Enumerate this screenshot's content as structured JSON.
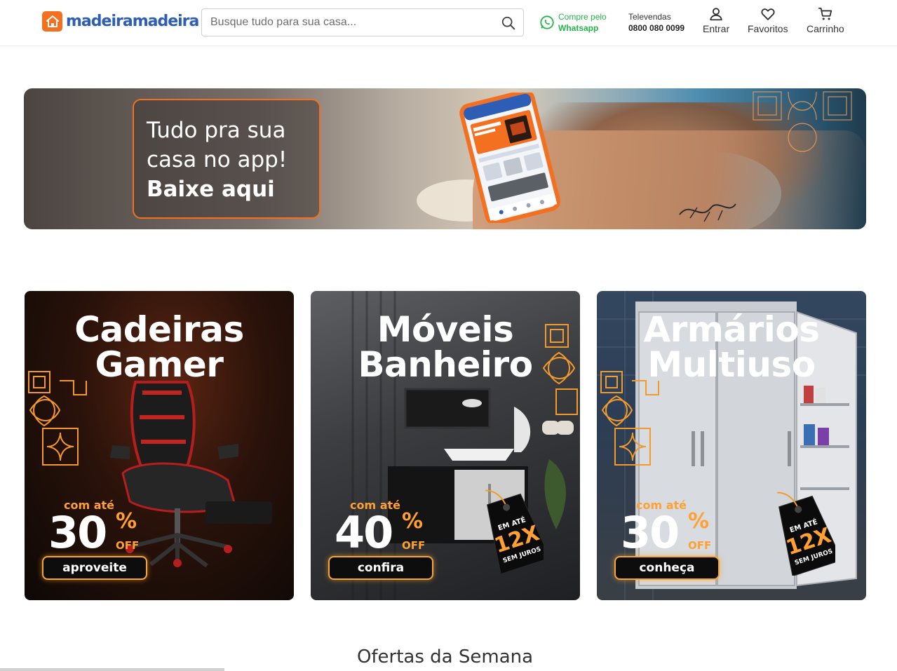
{
  "header": {
    "logo": {
      "part1": "madeira",
      "part2": "madeira"
    },
    "search": {
      "placeholder": "Busque tudo para sua casa..."
    },
    "whatsapp": {
      "line1": "Compre pelo",
      "line2": "Whatsapp"
    },
    "televendas": {
      "label": "Televendas",
      "phone": "0800 080 0099"
    },
    "nav": {
      "login": "Entrar",
      "favorites": "Favoritos",
      "cart": "Carrinho"
    }
  },
  "app_banner": {
    "line1": "Tudo pra sua",
    "line2": "casa no app!",
    "line3": "Baixe aqui"
  },
  "promo_cards": [
    {
      "title1": "Cadeiras",
      "title2": "Gamer",
      "prefix": "com até",
      "discount": "30",
      "pct": "%",
      "off": "OFF",
      "cta": "aproveite"
    },
    {
      "title1": "Móveis",
      "title2": "Banheiro",
      "prefix": "com até",
      "discount": "40",
      "pct": "%",
      "off": "OFF",
      "cta": "confira",
      "tag": {
        "l1": "EM ATÉ",
        "l2": "12X",
        "l3": "SEM JUROS"
      }
    },
    {
      "title1": "Armários",
      "title2": "Multiuso",
      "prefix": "com até",
      "discount": "30",
      "pct": "%",
      "off": "OFF",
      "cta": "conheça",
      "tag": {
        "l1": "EM ATÉ",
        "l2": "12X",
        "l3": "SEM JUROS"
      }
    }
  ],
  "offers_section": {
    "title": "Ofertas da Semana"
  },
  "colors": {
    "brand_orange": "#f37021",
    "brand_blue": "#2d5db5",
    "whatsapp_green": "#25b44a",
    "promo_orange": "#ffa033"
  }
}
